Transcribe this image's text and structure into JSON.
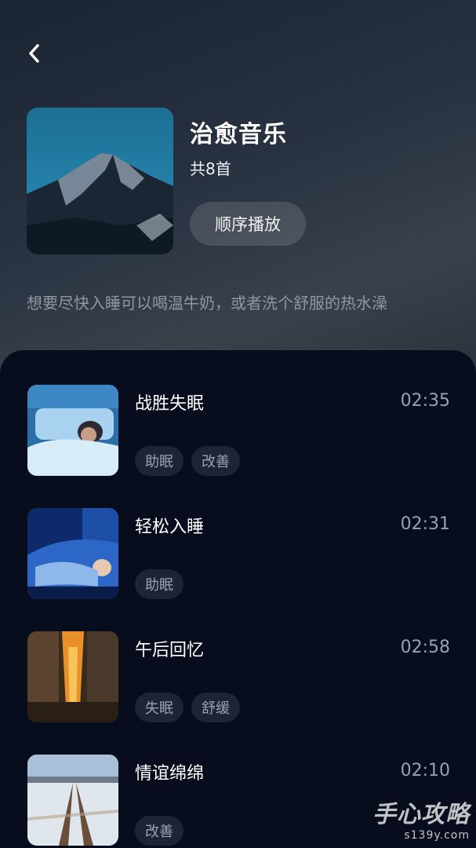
{
  "header": {
    "back_icon": "chevron-left-icon",
    "playlist_title": "治愈音乐",
    "track_count": "共8首",
    "play_button_label": "顺序播放",
    "description": "想要尽快入睡可以喝温牛奶，或者洗个舒服的热水澡"
  },
  "tracks": [
    {
      "title": "战胜失眠",
      "duration": "02:35",
      "tags": [
        "助眠",
        "改善"
      ]
    },
    {
      "title": "轻松入睡",
      "duration": "02:31",
      "tags": [
        "助眠"
      ]
    },
    {
      "title": "午后回忆",
      "duration": "02:58",
      "tags": [
        "失眠",
        "舒缓"
      ]
    },
    {
      "title": "情谊绵绵",
      "duration": "02:10",
      "tags": [
        "改善"
      ]
    }
  ],
  "watermark": {
    "line1": "手心攻略",
    "line2": "s139y.com"
  },
  "colors": {
    "background": "#070d1d",
    "tag_bg": "#1d2433",
    "muted_text": "#9aa2ae"
  }
}
